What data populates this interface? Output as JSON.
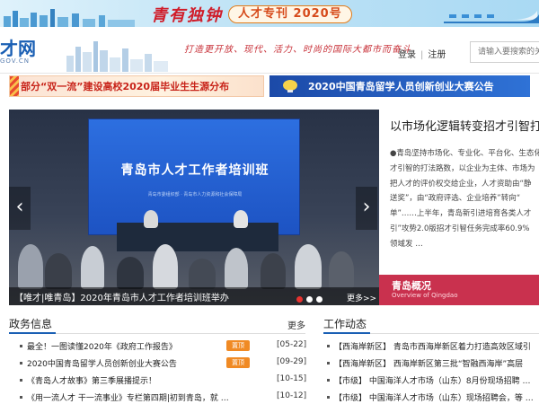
{
  "top_banner": {
    "calligraphy": "青有独钟",
    "special_label": "人才专刊 2020号"
  },
  "header": {
    "logo_text": "才网",
    "logo_sub": "GOV.CN",
    "slogan": "打造更开放、现代、活力、时尚的国际大都市而奋斗",
    "login": "登录",
    "separator": "|",
    "register": "注册",
    "search_placeholder": "请输入要搜索的关"
  },
  "ads": {
    "left": "部分“双一流”建设高校2020届毕业生生源分布",
    "right": "2020中国青岛留学人员创新创业大赛公告"
  },
  "carousel": {
    "screen_title": "青岛市人才工作者培训班",
    "screen_small": "青岛市委组织部 · 青岛市人力资源和社会保障局",
    "caption": "【唯才|唯青岛】2020年青岛市人才工作者培训班举办",
    "more": "更多>>",
    "prev_icon": "‹",
    "next_icon": "›"
  },
  "article": {
    "title": "以市场化逻辑转变招才引智打法",
    "lines": [
      "●青岛坚持市场化、专业化、平台化、生态化",
      "才引智的打法路数，以企业为主体、市场为",
      "把人才的评价权交给企业，人才资助由“静",
      "送奖”，由“政府评选、企业培养”转向“",
      "单”……上半年，青岛新引进培育各类人才",
      "引”攻势2.0版招才引智任务完成率60.9%",
      "领域发 …"
    ]
  },
  "overview": {
    "title": "青岛概况",
    "subtitle": "Overview of Qingdao"
  },
  "politics": {
    "name": "政务信息",
    "more": "更多",
    "items": [
      {
        "text": "最全！一图读懂2020年《政府工作报告》",
        "hot": "置顶",
        "date": "[05-22]"
      },
      {
        "text": "2020中国青岛留学人员创新创业大赛公告",
        "hot": "置顶",
        "date": "[09-29]"
      },
      {
        "text": "《青岛人才故事》第三季展播提示！",
        "hot": "",
        "date": "[10-15]"
      },
      {
        "text": "《用一流人才 干一流事业》专栏第四期|初到青岛，就 …",
        "hot": "",
        "date": "[10-12]"
      }
    ]
  },
  "work": {
    "name": "工作动态",
    "items": [
      {
        "text": "【西海岸新区】 青岛市西海岸新区着力打造高效区域引"
      },
      {
        "text": "【西海岸新区】 西海岸新区第三批“智融西海岸”高层"
      },
      {
        "text": "【市级】 中国海洋人才市场（山东）8月份现场招聘 …"
      },
      {
        "text": "【市级】 中国海洋人才市场（山东）现场招聘会，等 …"
      }
    ]
  },
  "colors": {
    "brand_blue": "#1a5fb4",
    "accent_red": "#c9314e",
    "hot_orange": "#f08a24"
  }
}
